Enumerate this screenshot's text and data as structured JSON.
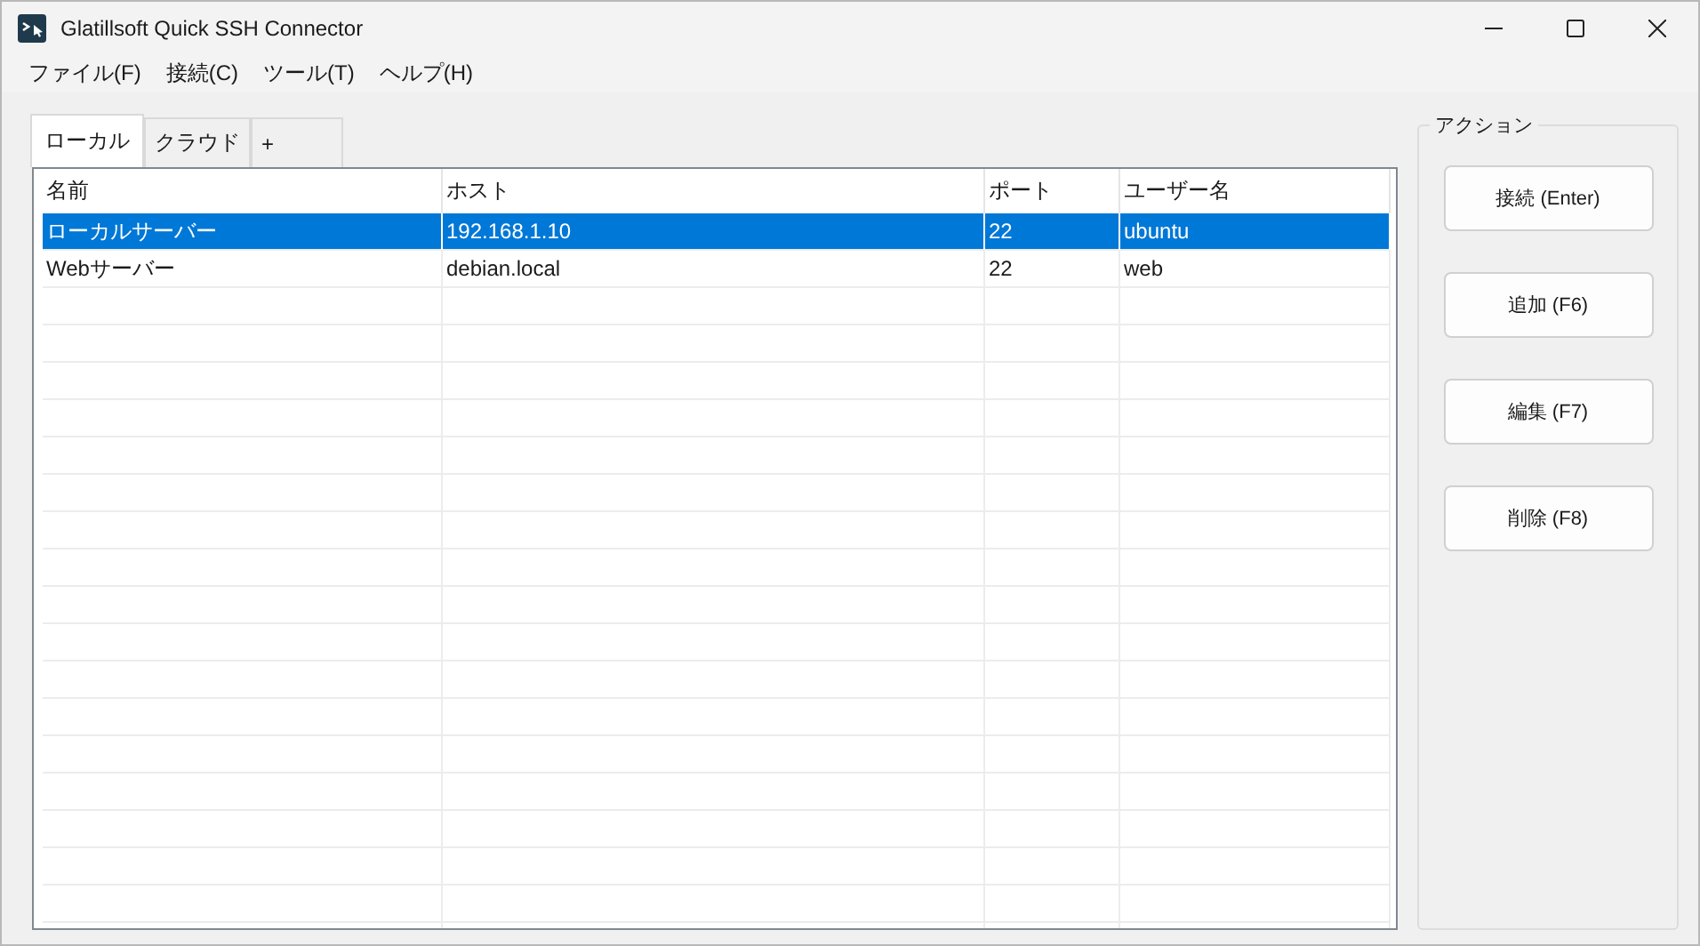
{
  "window": {
    "title": "Glatillsoft Quick SSH Connector"
  },
  "menu": [
    {
      "label": "ファイル(F)"
    },
    {
      "label": "接続(C)"
    },
    {
      "label": "ツール(T)"
    },
    {
      "label": "ヘルプ(H)"
    }
  ],
  "tabs": [
    {
      "label": "ローカル",
      "selected": true
    },
    {
      "label": "クラウド",
      "selected": false
    },
    {
      "label": "+",
      "selected": false
    }
  ],
  "table": {
    "columns": [
      "名前",
      "ホスト",
      "ポート",
      "ユーザー名"
    ],
    "rows": [
      {
        "cells": [
          "ローカルサーバー",
          "192.168.1.10",
          "22",
          "ubuntu"
        ],
        "selected": true
      },
      {
        "cells": [
          "Webサーバー",
          "debian.local",
          "22",
          "web"
        ],
        "selected": false
      }
    ]
  },
  "actions": {
    "title": "アクション",
    "buttons": [
      "接続 (Enter)",
      "追加 (F6)",
      "編集 (F7)",
      "削除 (F8)"
    ]
  }
}
